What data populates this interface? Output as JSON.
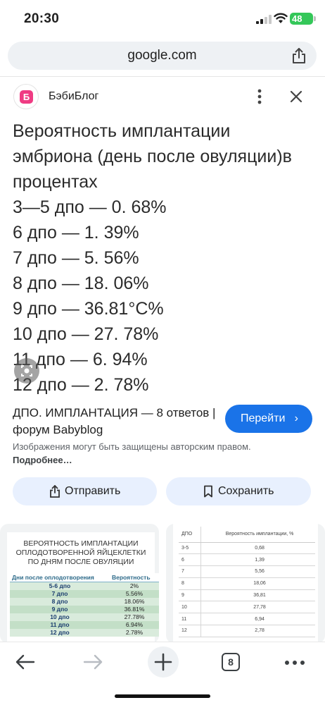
{
  "status_bar": {
    "time": "20:30",
    "battery": "48"
  },
  "browser": {
    "url": "google.com"
  },
  "source": {
    "favicon_letter": "Б",
    "name": "БэбиБлог"
  },
  "hero": {
    "lines": [
      "Вероятность имплантации",
      "эмбриона (день после овуляции)в",
      "процентах",
      "3—5 дпо — 0. 68%",
      "6 дпо — 1. 39%",
      "7 дпо — 5. 56%",
      "8 дпо — 18. 06%",
      "9 дпо — 36.81°С%",
      "10 дпо — 27. 78%",
      "11 дпо — 6. 94%",
      "12 дпо — 2. 78%"
    ]
  },
  "result": {
    "title": "ДПО. ИМПЛАНТАЦИЯ — 8 ответов | форум Babyblog",
    "goto_label": "Перейти",
    "copyright_text": "Изображения могут быть защищены авторским правом.",
    "more_label": "Подробнее…"
  },
  "actions": {
    "send_label": "Отправить",
    "save_label": "Сохранить"
  },
  "thumb1": {
    "title": "ВЕРОЯТНОСТЬ ИМПЛАНТАЦИИ ОПЛОДОТВОРЕННОЙ ЯЙЦЕКЛЕТКИ ПО ДНЯМ ПОСЛЕ ОВУЛЯЦИИ",
    "headers": [
      "Дни после оплодотворения",
      "Вероятность"
    ],
    "rows": [
      [
        "5-6 дпо",
        "2%"
      ],
      [
        "7 дпо",
        "5.56%"
      ],
      [
        "8 дпо",
        "18.06%"
      ],
      [
        "9 дпо",
        "36.81%"
      ],
      [
        "10 дпо",
        "27.78%"
      ],
      [
        "11 дпо",
        "6.94%"
      ],
      [
        "12 дпо",
        "2.78%"
      ]
    ]
  },
  "thumb2": {
    "headers": [
      "ДПО",
      "Вероятность имплантации, %"
    ],
    "rows": [
      [
        "3-5",
        "0,68"
      ],
      [
        "6",
        "1,39"
      ],
      [
        "7",
        "5,56"
      ],
      [
        "8",
        "18,06"
      ],
      [
        "9",
        "36,81"
      ],
      [
        "10",
        "27,78"
      ],
      [
        "11",
        "6,94"
      ],
      [
        "12",
        "2,78"
      ]
    ]
  },
  "toolbar": {
    "tab_count": "8"
  },
  "colors": {
    "accent": "#1a73e8",
    "brand": "#ef3b83",
    "chip_bg": "#e8f0fe",
    "battery": "#34c759"
  },
  "icons": [
    "signal-icon",
    "wifi-icon",
    "share-icon",
    "more-vert-icon",
    "close-icon",
    "lens-icon",
    "send-icon",
    "bookmark-icon",
    "back-arrow-icon",
    "forward-arrow-icon",
    "plus-icon",
    "tabs-icon",
    "more-horiz-icon"
  ]
}
